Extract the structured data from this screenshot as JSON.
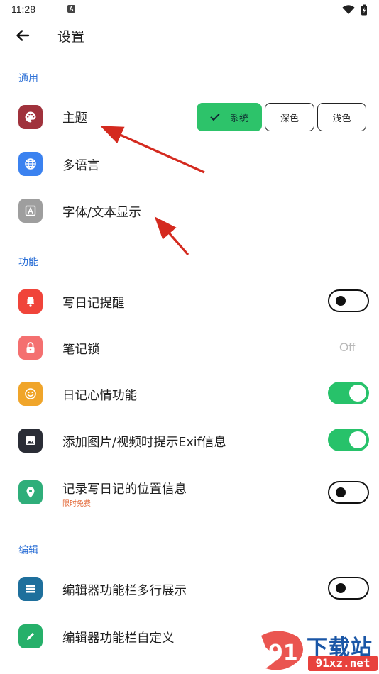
{
  "status": {
    "time": "11:28",
    "notification_badge": "A"
  },
  "header": {
    "title": "设置"
  },
  "sections": {
    "general": "通用",
    "features": "功能",
    "editor": "编辑"
  },
  "general_items": {
    "theme": {
      "label": "主题",
      "options": {
        "system": "系统",
        "dark": "深色",
        "light": "浅色"
      },
      "selected": "系统"
    },
    "language": {
      "label": "多语言"
    },
    "font": {
      "label": "字体/文本显示"
    }
  },
  "feature_items": {
    "reminder": {
      "label": "写日记提醒",
      "on": false
    },
    "lock": {
      "label": "笔记锁",
      "value": "Off"
    },
    "mood": {
      "label": "日记心情功能",
      "on": true
    },
    "exif": {
      "label": "添加图片/视频时提示Exif信息",
      "on": true
    },
    "location": {
      "label": "记录写日记的位置信息",
      "badge": "限时免费",
      "on": false
    }
  },
  "editor_items": {
    "multiline": {
      "label": "编辑器功能栏多行展示",
      "on": false
    },
    "customize": {
      "label": "编辑器功能栏自定义"
    }
  },
  "watermark": {
    "brand": "下载站",
    "url": "91xz.net",
    "logo_text": "91"
  },
  "colors": {
    "accent": "#2b6fd6",
    "toggle_on": "#27c26a",
    "arrow": "#d42a1f",
    "badge": "#e2622f"
  }
}
